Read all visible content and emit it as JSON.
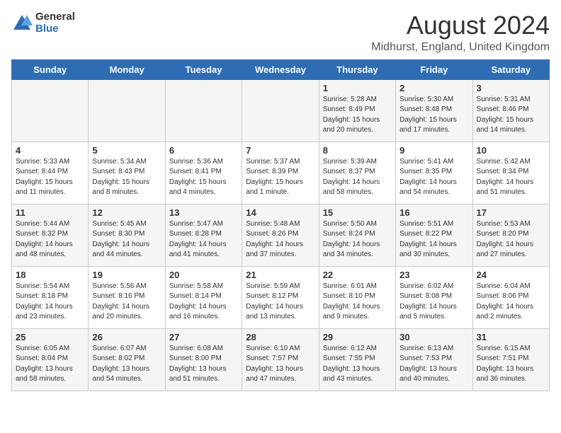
{
  "logo": {
    "general": "General",
    "blue": "Blue"
  },
  "title": "August 2024",
  "subtitle": "Midhurst, England, United Kingdom",
  "days_of_week": [
    "Sunday",
    "Monday",
    "Tuesday",
    "Wednesday",
    "Thursday",
    "Friday",
    "Saturday"
  ],
  "weeks": [
    [
      {
        "day": "",
        "info": ""
      },
      {
        "day": "",
        "info": ""
      },
      {
        "day": "",
        "info": ""
      },
      {
        "day": "",
        "info": ""
      },
      {
        "day": "1",
        "info": "Sunrise: 5:28 AM\nSunset: 8:49 PM\nDaylight: 15 hours\nand 20 minutes."
      },
      {
        "day": "2",
        "info": "Sunrise: 5:30 AM\nSunset: 8:48 PM\nDaylight: 15 hours\nand 17 minutes."
      },
      {
        "day": "3",
        "info": "Sunrise: 5:31 AM\nSunset: 8:46 PM\nDaylight: 15 hours\nand 14 minutes."
      }
    ],
    [
      {
        "day": "4",
        "info": "Sunrise: 5:33 AM\nSunset: 8:44 PM\nDaylight: 15 hours\nand 11 minutes."
      },
      {
        "day": "5",
        "info": "Sunrise: 5:34 AM\nSunset: 8:43 PM\nDaylight: 15 hours\nand 8 minutes."
      },
      {
        "day": "6",
        "info": "Sunrise: 5:36 AM\nSunset: 8:41 PM\nDaylight: 15 hours\nand 4 minutes."
      },
      {
        "day": "7",
        "info": "Sunrise: 5:37 AM\nSunset: 8:39 PM\nDaylight: 15 hours\nand 1 minute."
      },
      {
        "day": "8",
        "info": "Sunrise: 5:39 AM\nSunset: 8:37 PM\nDaylight: 14 hours\nand 58 minutes."
      },
      {
        "day": "9",
        "info": "Sunrise: 5:41 AM\nSunset: 8:35 PM\nDaylight: 14 hours\nand 54 minutes."
      },
      {
        "day": "10",
        "info": "Sunrise: 5:42 AM\nSunset: 8:34 PM\nDaylight: 14 hours\nand 51 minutes."
      }
    ],
    [
      {
        "day": "11",
        "info": "Sunrise: 5:44 AM\nSunset: 8:32 PM\nDaylight: 14 hours\nand 48 minutes."
      },
      {
        "day": "12",
        "info": "Sunrise: 5:45 AM\nSunset: 8:30 PM\nDaylight: 14 hours\nand 44 minutes."
      },
      {
        "day": "13",
        "info": "Sunrise: 5:47 AM\nSunset: 8:28 PM\nDaylight: 14 hours\nand 41 minutes."
      },
      {
        "day": "14",
        "info": "Sunrise: 5:48 AM\nSunset: 8:26 PM\nDaylight: 14 hours\nand 37 minutes."
      },
      {
        "day": "15",
        "info": "Sunrise: 5:50 AM\nSunset: 8:24 PM\nDaylight: 14 hours\nand 34 minutes."
      },
      {
        "day": "16",
        "info": "Sunrise: 5:51 AM\nSunset: 8:22 PM\nDaylight: 14 hours\nand 30 minutes."
      },
      {
        "day": "17",
        "info": "Sunrise: 5:53 AM\nSunset: 8:20 PM\nDaylight: 14 hours\nand 27 minutes."
      }
    ],
    [
      {
        "day": "18",
        "info": "Sunrise: 5:54 AM\nSunset: 8:18 PM\nDaylight: 14 hours\nand 23 minutes."
      },
      {
        "day": "19",
        "info": "Sunrise: 5:56 AM\nSunset: 8:16 PM\nDaylight: 14 hours\nand 20 minutes."
      },
      {
        "day": "20",
        "info": "Sunrise: 5:58 AM\nSunset: 8:14 PM\nDaylight: 14 hours\nand 16 minutes."
      },
      {
        "day": "21",
        "info": "Sunrise: 5:59 AM\nSunset: 8:12 PM\nDaylight: 14 hours\nand 13 minutes."
      },
      {
        "day": "22",
        "info": "Sunrise: 6:01 AM\nSunset: 8:10 PM\nDaylight: 14 hours\nand 9 minutes."
      },
      {
        "day": "23",
        "info": "Sunrise: 6:02 AM\nSunset: 8:08 PM\nDaylight: 14 hours\nand 5 minutes."
      },
      {
        "day": "24",
        "info": "Sunrise: 6:04 AM\nSunset: 8:06 PM\nDaylight: 14 hours\nand 2 minutes."
      }
    ],
    [
      {
        "day": "25",
        "info": "Sunrise: 6:05 AM\nSunset: 8:04 PM\nDaylight: 13 hours\nand 58 minutes."
      },
      {
        "day": "26",
        "info": "Sunrise: 6:07 AM\nSunset: 8:02 PM\nDaylight: 13 hours\nand 54 minutes."
      },
      {
        "day": "27",
        "info": "Sunrise: 6:08 AM\nSunset: 8:00 PM\nDaylight: 13 hours\nand 51 minutes."
      },
      {
        "day": "28",
        "info": "Sunrise: 6:10 AM\nSunset: 7:57 PM\nDaylight: 13 hours\nand 47 minutes."
      },
      {
        "day": "29",
        "info": "Sunrise: 6:12 AM\nSunset: 7:55 PM\nDaylight: 13 hours\nand 43 minutes."
      },
      {
        "day": "30",
        "info": "Sunrise: 6:13 AM\nSunset: 7:53 PM\nDaylight: 13 hours\nand 40 minutes."
      },
      {
        "day": "31",
        "info": "Sunrise: 6:15 AM\nSunset: 7:51 PM\nDaylight: 13 hours\nand 36 minutes."
      }
    ]
  ]
}
